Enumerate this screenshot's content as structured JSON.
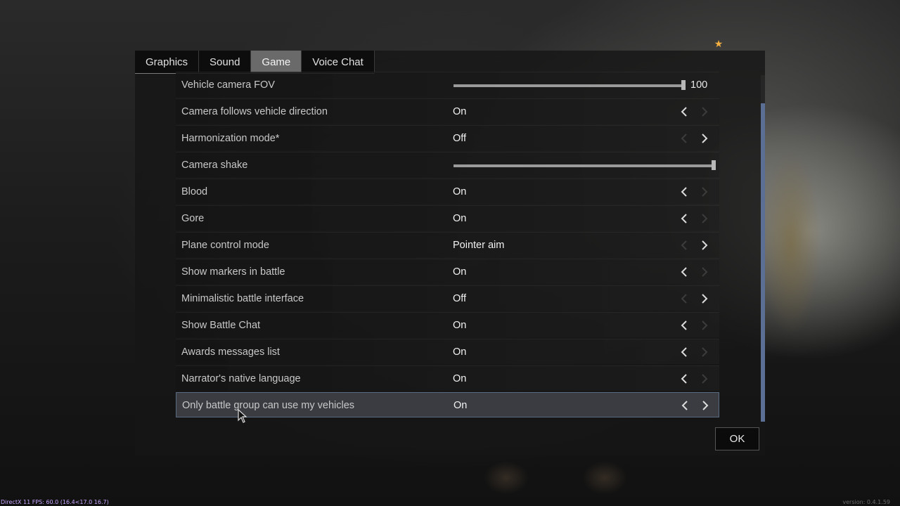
{
  "tabs": [
    {
      "label": "Graphics",
      "active": false
    },
    {
      "label": "Sound",
      "active": false
    },
    {
      "label": "Game",
      "active": true
    },
    {
      "label": "Voice Chat",
      "active": false
    }
  ],
  "settings": [
    {
      "label": "Vehicle camera FOV",
      "type": "slider",
      "level": 0.99,
      "value_text": "100"
    },
    {
      "label": "Camera follows vehicle direction",
      "type": "toggle",
      "value": "On",
      "left_enabled": true,
      "right_enabled": false
    },
    {
      "label": "Harmonization mode*",
      "type": "toggle",
      "value": "Off",
      "left_enabled": false,
      "right_enabled": true
    },
    {
      "label": "Camera shake",
      "type": "slider",
      "level": 1.0,
      "value_text": ""
    },
    {
      "label": "Blood",
      "type": "toggle",
      "value": "On",
      "left_enabled": true,
      "right_enabled": false
    },
    {
      "label": "Gore",
      "type": "toggle",
      "value": "On",
      "left_enabled": true,
      "right_enabled": false
    },
    {
      "label": "Plane control mode",
      "type": "toggle",
      "value": "Pointer aim",
      "left_enabled": false,
      "right_enabled": true
    },
    {
      "label": "Show markers in battle",
      "type": "toggle",
      "value": "On",
      "left_enabled": true,
      "right_enabled": false
    },
    {
      "label": "Minimalistic battle interface",
      "type": "toggle",
      "value": "Off",
      "left_enabled": false,
      "right_enabled": true
    },
    {
      "label": "Show Battle Chat",
      "type": "toggle",
      "value": "On",
      "left_enabled": true,
      "right_enabled": false
    },
    {
      "label": "Awards messages list",
      "type": "toggle",
      "value": "On",
      "left_enabled": true,
      "right_enabled": false
    },
    {
      "label": "Narrator's native language",
      "type": "toggle",
      "value": "On",
      "left_enabled": true,
      "right_enabled": false
    },
    {
      "label": "Only battle group can use my vehicles",
      "type": "toggle",
      "value": "On",
      "left_enabled": true,
      "right_enabled": true,
      "selected": true
    }
  ],
  "ok_label": "OK",
  "footer": {
    "fps_text": "DirectX 11 FPS: 60.0 (16.4<17.0 16.7)",
    "version_text": "version: 0.4.1.59"
  },
  "colors": {
    "accent": "#5b6f95",
    "active_tab": "#6a6a6a",
    "fps_text": "#c9a6ff"
  }
}
